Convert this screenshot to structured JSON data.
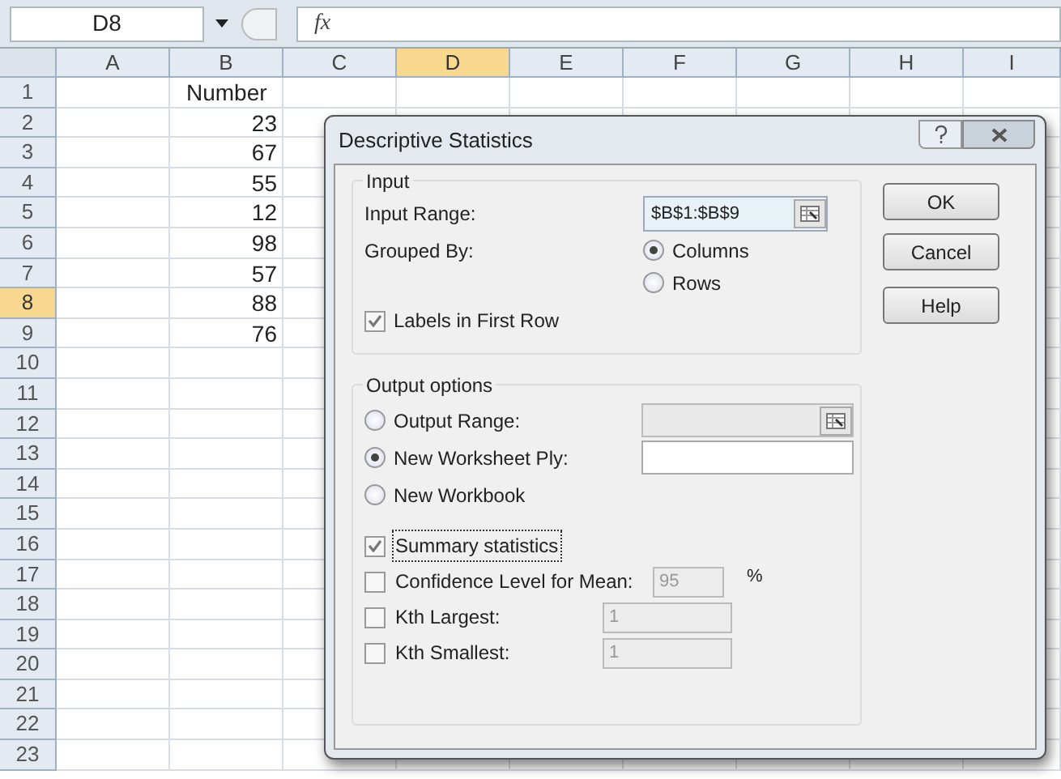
{
  "name_box": "D8",
  "formula_bar": {
    "fx": "fx"
  },
  "columns": [
    {
      "label": "A",
      "selected": false
    },
    {
      "label": "B",
      "selected": false
    },
    {
      "label": "C",
      "selected": false
    },
    {
      "label": "D",
      "selected": true
    },
    {
      "label": "E",
      "selected": false
    },
    {
      "label": "F",
      "selected": false
    },
    {
      "label": "G",
      "selected": false
    },
    {
      "label": "H",
      "selected": false
    },
    {
      "label": "I",
      "selected": false
    }
  ],
  "rows": [
    {
      "header": "1",
      "selected": false,
      "column_b": {
        "text": "Number",
        "kind": "text"
      }
    },
    {
      "header": "2",
      "selected": false,
      "column_b": {
        "text": "23",
        "kind": "number"
      }
    },
    {
      "header": "3",
      "selected": false,
      "column_b": {
        "text": "67",
        "kind": "number"
      }
    },
    {
      "header": "4",
      "selected": false,
      "column_b": {
        "text": "55",
        "kind": "number"
      }
    },
    {
      "header": "5",
      "selected": false,
      "column_b": {
        "text": "12",
        "kind": "number"
      }
    },
    {
      "header": "6",
      "selected": false,
      "column_b": {
        "text": "98",
        "kind": "number"
      }
    },
    {
      "header": "7",
      "selected": false,
      "column_b": {
        "text": "57",
        "kind": "number"
      }
    },
    {
      "header": "8",
      "selected": true,
      "column_b": {
        "text": "88",
        "kind": "number"
      }
    },
    {
      "header": "9",
      "selected": false,
      "column_b": {
        "text": "76",
        "kind": "number"
      }
    },
    {
      "header": "10",
      "selected": false
    },
    {
      "header": "11",
      "selected": false
    },
    {
      "header": "12",
      "selected": false
    },
    {
      "header": "13",
      "selected": false
    },
    {
      "header": "14",
      "selected": false
    },
    {
      "header": "15",
      "selected": false
    },
    {
      "header": "16",
      "selected": false
    },
    {
      "header": "17",
      "selected": false
    },
    {
      "header": "18",
      "selected": false
    },
    {
      "header": "19",
      "selected": false
    },
    {
      "header": "20",
      "selected": false
    },
    {
      "header": "21",
      "selected": false
    },
    {
      "header": "22",
      "selected": false
    },
    {
      "header": "23",
      "selected": false
    }
  ],
  "dialog": {
    "title": "Descriptive Statistics",
    "input": {
      "title": "Input",
      "input_range": {
        "label": "Input Range:",
        "value": "$B$1:$B$9"
      },
      "grouped_by": {
        "label": "Grouped By:",
        "options": [
          {
            "label": "Columns",
            "selected": true
          },
          {
            "label": "Rows",
            "selected": false
          }
        ]
      },
      "labels_in_first_row": {
        "label": "Labels in First Row",
        "checked": true
      }
    },
    "output": {
      "title": "Output options",
      "options": [
        {
          "label": "Output Range:",
          "selected": false,
          "field_disabled": true,
          "range_button": true
        },
        {
          "label": "New Worksheet Ply:",
          "selected": true,
          "field_disabled": false,
          "range_button": false
        },
        {
          "label": "New Workbook",
          "selected": false
        }
      ],
      "checks": [
        {
          "label": "Summary statistics",
          "checked": true,
          "focused": true
        },
        {
          "label": "Confidence Level for Mean:",
          "checked": false,
          "focused": false,
          "field": "95",
          "unit": "%"
        },
        {
          "label": "Kth Largest:",
          "checked": false,
          "focused": false,
          "field": "1"
        },
        {
          "label": "Kth Smallest:",
          "checked": false,
          "focused": false,
          "field": "1"
        }
      ]
    },
    "buttons": [
      {
        "label": "OK",
        "kind": "ok"
      },
      {
        "label": "Cancel",
        "kind": "cancel"
      },
      {
        "label": "Help",
        "kind": "help"
      }
    ]
  }
}
